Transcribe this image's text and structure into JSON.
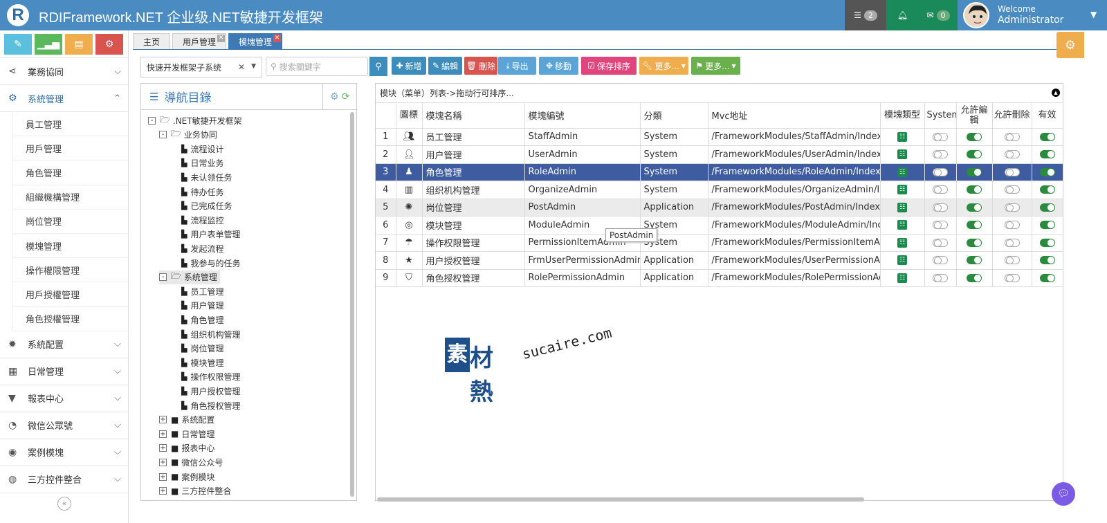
{
  "header": {
    "logo_letter": "R",
    "title": "RDIFramework.NET 企业级.NET敏捷开发框架",
    "tasks_icon": "tasks-icon",
    "tasks_count": "2",
    "bell_icon": "bell-icon",
    "mail_icon": "envelope-icon",
    "mail_count": "0",
    "welcome": "Welcome",
    "user_name": "Administrator"
  },
  "sidebar": {
    "quick_buttons": [
      {
        "icon": "pencil-icon",
        "color": "#5bc0de"
      },
      {
        "icon": "signal-icon",
        "color": "#5cb85c"
      },
      {
        "icon": "book-icon",
        "color": "#f0ad4e"
      },
      {
        "icon": "cogs-icon",
        "color": "#d9534f"
      }
    ],
    "menus_top": [
      {
        "label": "業務協同",
        "icon": "share-icon"
      },
      {
        "label": "系統管理",
        "icon": "cogs-icon",
        "active": true
      }
    ],
    "sub_items": [
      "員工管理",
      "用戶管理",
      "角色管理",
      "組織機構管理",
      "崗位管理",
      "模塊管理",
      "操作權限管理",
      "用戶授權管理",
      "角色授權管理"
    ],
    "menus_bottom": [
      {
        "label": "系統配置",
        "icon": "gear-icon"
      },
      {
        "label": "日常管理",
        "icon": "calendar-icon"
      },
      {
        "label": "報表中心",
        "icon": "filter-icon"
      },
      {
        "label": "微信公眾號",
        "icon": "wechat-icon"
      },
      {
        "label": "案例模塊",
        "icon": "eye-icon"
      },
      {
        "label": "三方控件整合",
        "icon": "globe-icon"
      }
    ],
    "collapse": "«"
  },
  "tabs": [
    {
      "label": "主页",
      "closable": false,
      "active": false
    },
    {
      "label": "用戶管理",
      "closable": true,
      "active": false
    },
    {
      "label": "模塊管理",
      "closable": true,
      "active": true
    }
  ],
  "toolbar": {
    "subsystem_value": "快速开发框架子系统",
    "search_placeholder": "搜索關鍵字",
    "buttons": [
      {
        "label": "新增",
        "icon": "plus-icon",
        "color": "#3c8dbc"
      },
      {
        "label": "編輯",
        "icon": "edit-icon",
        "color": "#3c8dbc"
      },
      {
        "label": "刪除",
        "icon": "trash-icon",
        "color": "#d9534f"
      },
      {
        "label": "导出",
        "icon": "download-icon",
        "color": "#5ba4d8"
      },
      {
        "label": "移動",
        "icon": "move-icon",
        "color": "#5ba4d8"
      },
      {
        "label": "保存排序",
        "icon": "check-square-icon",
        "color": "#e1457d"
      },
      {
        "label": "更多...",
        "icon": "wrench-icon",
        "color": "#f0ad4e"
      },
      {
        "label": "更多...",
        "icon": "flag-icon",
        "color": "#6ab04c"
      }
    ]
  },
  "tree": {
    "title": "導航目錄",
    "nodes": [
      {
        "label": ".NET敏捷开发框架",
        "level": 0,
        "type": "folder-open",
        "toggle": "-"
      },
      {
        "label": "业务协同",
        "level": 1,
        "type": "folder-open",
        "toggle": "-"
      },
      {
        "label": "流程设计",
        "level": 2,
        "type": "file"
      },
      {
        "label": "日常业务",
        "level": 2,
        "type": "file"
      },
      {
        "label": "未认领任务",
        "level": 2,
        "type": "file"
      },
      {
        "label": "待办任务",
        "level": 2,
        "type": "file"
      },
      {
        "label": "已完成任务",
        "level": 2,
        "type": "file"
      },
      {
        "label": "流程监控",
        "level": 2,
        "type": "file"
      },
      {
        "label": "用户表单管理",
        "level": 2,
        "type": "file"
      },
      {
        "label": "发起流程",
        "level": 2,
        "type": "file"
      },
      {
        "label": "我参与的任务",
        "level": 2,
        "type": "file"
      },
      {
        "label": "系统管理",
        "level": 1,
        "type": "folder-open",
        "toggle": "-",
        "selected": true
      },
      {
        "label": "员工管理",
        "level": 2,
        "type": "file"
      },
      {
        "label": "用户管理",
        "level": 2,
        "type": "file"
      },
      {
        "label": "角色管理",
        "level": 2,
        "type": "file"
      },
      {
        "label": "组织机构管理",
        "level": 2,
        "type": "file"
      },
      {
        "label": "岗位管理",
        "level": 2,
        "type": "file"
      },
      {
        "label": "模块管理",
        "level": 2,
        "type": "file"
      },
      {
        "label": "操作权限管理",
        "level": 2,
        "type": "file"
      },
      {
        "label": "用户授权管理",
        "level": 2,
        "type": "file"
      },
      {
        "label": "角色授权管理",
        "level": 2,
        "type": "file"
      },
      {
        "label": "系统配置",
        "level": 1,
        "type": "folder",
        "toggle": "+"
      },
      {
        "label": "日常管理",
        "level": 1,
        "type": "folder",
        "toggle": "+"
      },
      {
        "label": "报表中心",
        "level": 1,
        "type": "folder",
        "toggle": "+"
      },
      {
        "label": "微信公众号",
        "level": 1,
        "type": "folder",
        "toggle": "+"
      },
      {
        "label": "案例模块",
        "level": 1,
        "type": "folder",
        "toggle": "+"
      },
      {
        "label": "三方控件整合",
        "level": 1,
        "type": "folder",
        "toggle": "+"
      }
    ]
  },
  "grid": {
    "caption": "模块（菜单）列表->拖动行可排序...",
    "columns": [
      "",
      "圖標",
      "模塊名稱",
      "模塊編號",
      "分類",
      "Mvc地址",
      "模塊類型",
      "System",
      "允許編輯",
      "允許刪除",
      "有效"
    ],
    "rows": [
      {
        "no": "1",
        "icon": "users-icon",
        "name": "员工管理",
        "code": "StaffAdmin",
        "category": "System",
        "url": "/FrameworkModules/StaffAdmin/Index",
        "system": false,
        "edit": true,
        "del": false,
        "enabled": true
      },
      {
        "no": "2",
        "icon": "user-icon",
        "name": "用户管理",
        "code": "UserAdmin",
        "category": "System",
        "url": "/FrameworkModules/UserAdmin/Index",
        "system": false,
        "edit": true,
        "del": false,
        "enabled": true
      },
      {
        "no": "3",
        "icon": "user-secret-icon",
        "name": "角色管理",
        "code": "RoleAdmin",
        "category": "System",
        "url": "/FrameworkModules/RoleAdmin/IndexI",
        "system": false,
        "edit": true,
        "del": false,
        "enabled": true,
        "selected": true
      },
      {
        "no": "4",
        "icon": "building-icon",
        "name": "组织机构管理",
        "code": "OrganizeAdmin",
        "category": "System",
        "url": "/FrameworkModules/OrganizeAdmin/In",
        "system": false,
        "edit": true,
        "del": false,
        "enabled": true
      },
      {
        "no": "5",
        "icon": "rebel-icon",
        "name": "岗位管理",
        "code": "PostAdmin",
        "category": "Application",
        "url": "/FrameworkModules/PostAdmin/Index",
        "system": false,
        "edit": true,
        "del": false,
        "enabled": true,
        "hover": true
      },
      {
        "no": "6",
        "icon": "dot-circle-icon",
        "name": "模块管理",
        "code": "ModuleAdmin",
        "category": "System",
        "url": "/FrameworkModules/ModuleAdmin/Inc",
        "system": false,
        "edit": true,
        "del": false,
        "enabled": true
      },
      {
        "no": "7",
        "icon": "umbrella-icon",
        "name": "操作权限管理",
        "code": "PermissionItemAdmin",
        "category": "System",
        "url": "/FrameworkModules/PermissionItemAc",
        "system": false,
        "edit": true,
        "del": false,
        "enabled": true
      },
      {
        "no": "8",
        "icon": "star-icon",
        "name": "用户授权管理",
        "code": "FrmUserPermissionAdmin",
        "category": "Application",
        "url": "/FrameworkModules/UserPermissionAc",
        "system": false,
        "edit": true,
        "del": false,
        "enabled": true
      },
      {
        "no": "9",
        "icon": "shield-icon",
        "name": "角色授权管理",
        "code": "RolePermissionAdmin",
        "category": "Application",
        "url": "/FrameworkModules/RolePermissionAc",
        "system": false,
        "edit": true,
        "del": false,
        "enabled": true
      }
    ],
    "tooltip": "PostAdmin"
  },
  "watermark": {
    "cn_first": "素",
    "cn_rest": "材熱",
    "en": "sucaire.com"
  }
}
